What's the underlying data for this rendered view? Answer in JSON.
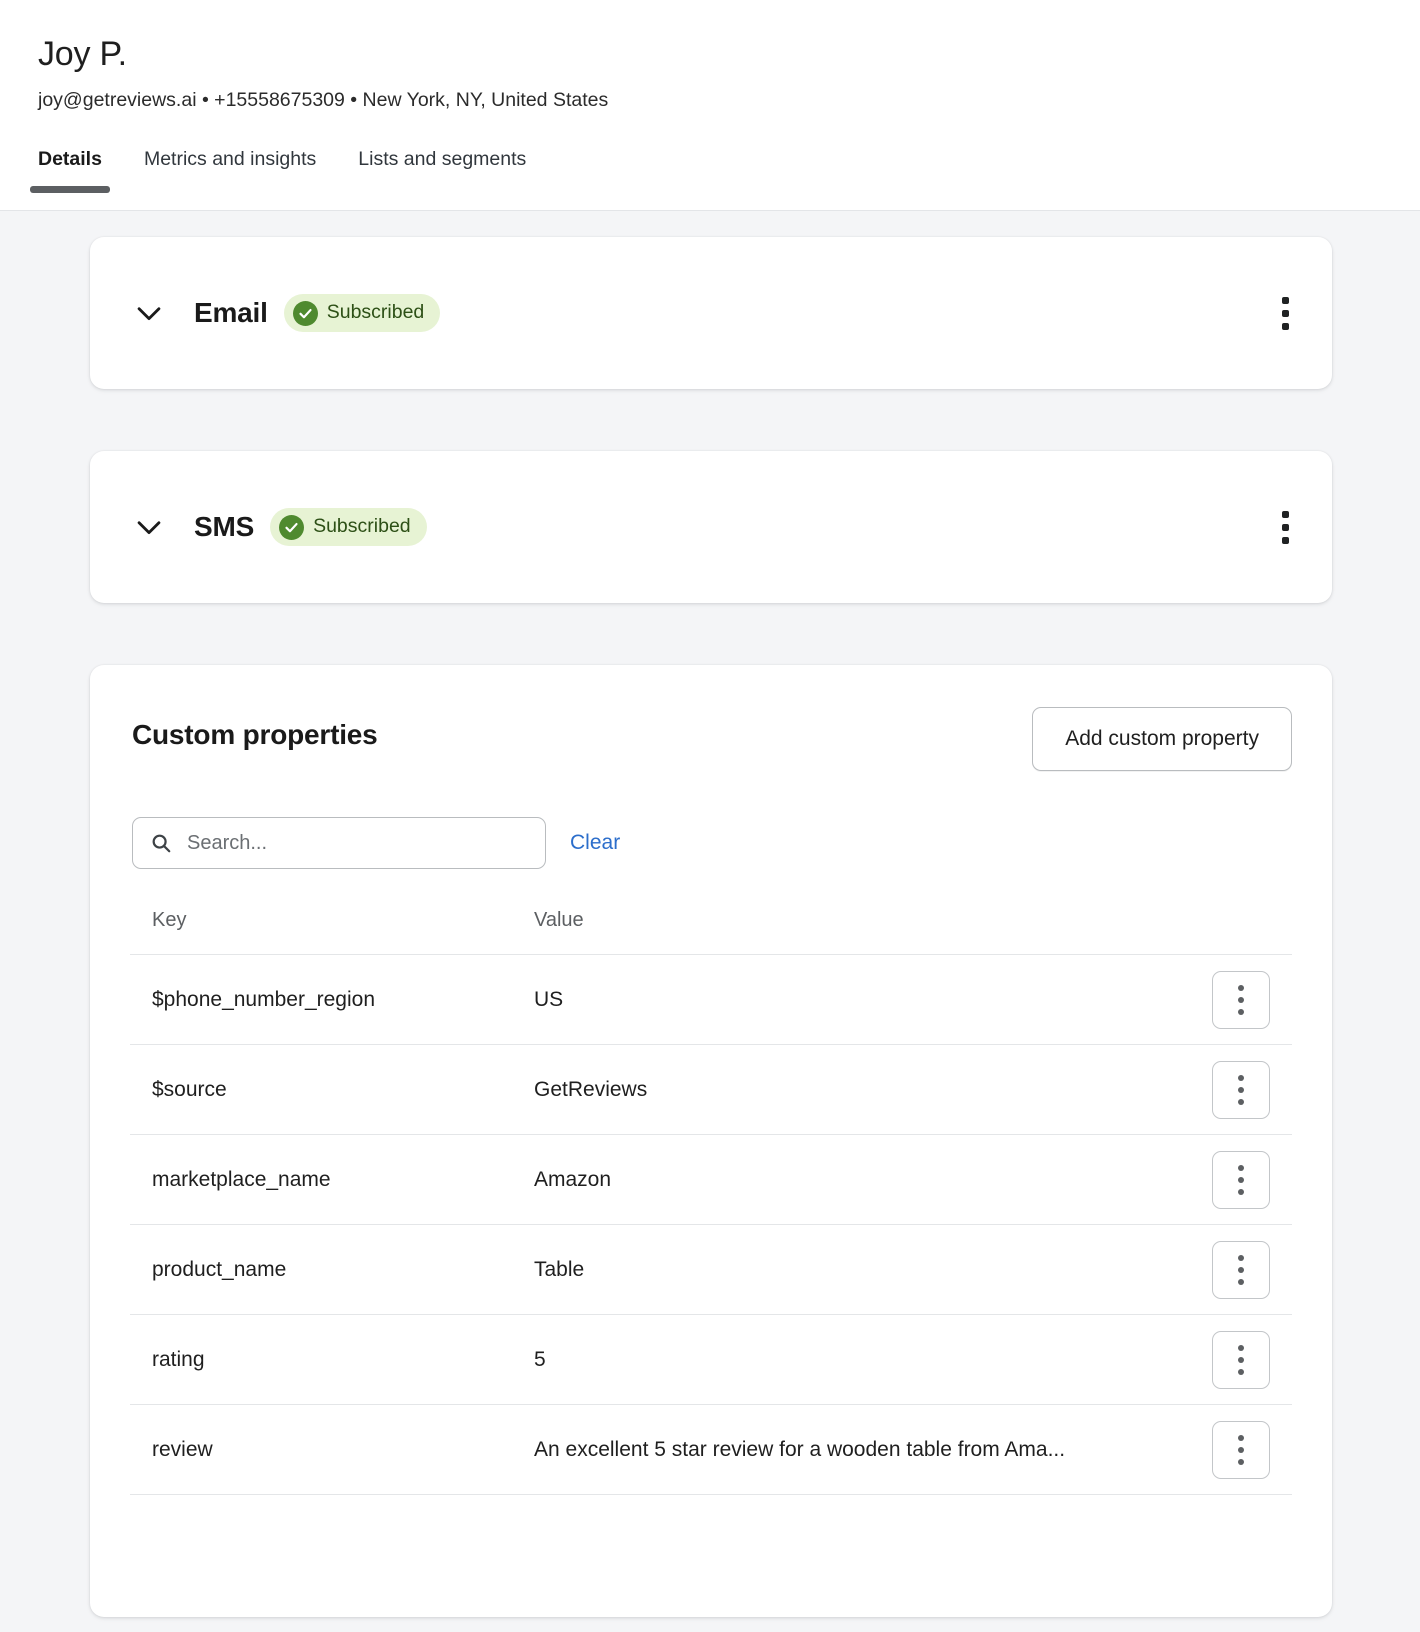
{
  "header": {
    "name": "Joy P.",
    "meta": "joy@getreviews.ai • +15558675309 • New York, NY, United States",
    "tabs": [
      {
        "label": "Details",
        "active": true
      },
      {
        "label": "Metrics and insights",
        "active": false
      },
      {
        "label": "Lists and segments",
        "active": false
      }
    ]
  },
  "channels": [
    {
      "title": "Email",
      "status": "Subscribed",
      "status_color": "#2d5016",
      "status_bg": "#e7f3d4",
      "status_icon": "check-circle-icon",
      "chevron": "chevron-down-icon",
      "menu_icon": "kebab-menu-icon"
    },
    {
      "title": "SMS",
      "status": "Subscribed",
      "status_color": "#2d5016",
      "status_bg": "#e7f3d4",
      "status_icon": "check-circle-icon",
      "chevron": "chevron-down-icon",
      "menu_icon": "kebab-menu-icon"
    }
  ],
  "custom_properties": {
    "title": "Custom properties",
    "add_button": "Add custom property",
    "search_placeholder": "Search...",
    "search_value": "",
    "search_icon": "search-icon",
    "clear_label": "Clear",
    "clear_color": "#2c6ecb",
    "columns": [
      "Key",
      "Value"
    ],
    "rows": [
      {
        "key": "$phone_number_region",
        "value": "US"
      },
      {
        "key": "$source",
        "value": "GetReviews"
      },
      {
        "key": "marketplace_name",
        "value": "Amazon"
      },
      {
        "key": "product_name",
        "value": "Table"
      },
      {
        "key": "rating",
        "value": "5"
      },
      {
        "key": "review",
        "value": "An excellent 5 star review for a wooden table from Ama..."
      }
    ]
  }
}
